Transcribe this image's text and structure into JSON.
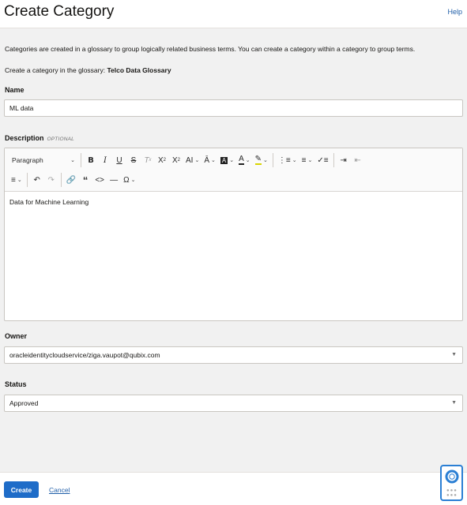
{
  "header": {
    "title": "Create Category",
    "help": "Help"
  },
  "intro_text": "Categories are created in a glossary to group logically related business terms. You can create a category within a category to group terms.",
  "glossary": {
    "prefix": "Create a category in the glossary:",
    "name": "Telco Data Glossary"
  },
  "name_field": {
    "label": "Name",
    "value": "ML data"
  },
  "description": {
    "label": "Description",
    "optional": "OPTIONAL",
    "paragraph_style": "Paragraph",
    "text": "Data for Machine Learning"
  },
  "owner": {
    "label": "Owner",
    "value": "oracleidentitycloudservice/ziga.vaupot@qubix.com"
  },
  "status": {
    "label": "Status",
    "value": "Approved"
  },
  "footer": {
    "create": "Create",
    "cancel": "Cancel"
  },
  "colors": {
    "primary": "#1e6cc8",
    "link": "#1f5ea8",
    "background": "#f1f1f1"
  }
}
